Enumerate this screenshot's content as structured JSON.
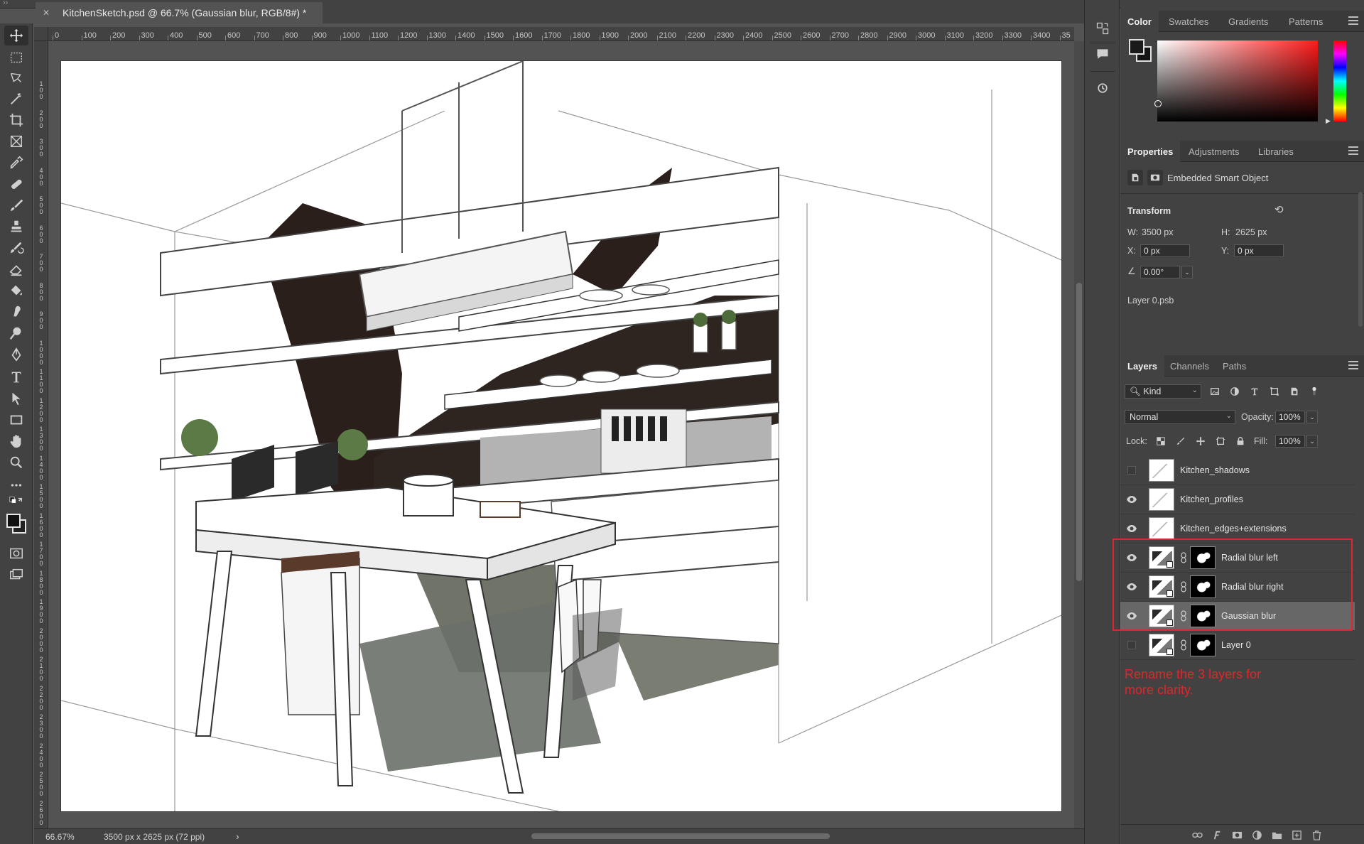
{
  "document": {
    "tab_title": "KitchenSketch.psd @ 66.7% (Gaussian blur, RGB/8#) *"
  },
  "ruler": {
    "top_ticks": [
      "0",
      "100",
      "200",
      "300",
      "400",
      "500",
      "600",
      "700",
      "800",
      "900",
      "1000",
      "1100",
      "1200",
      "1300",
      "1400",
      "1500",
      "1600",
      "1700",
      "1800",
      "1900",
      "2000",
      "2100",
      "2200",
      "2300",
      "2400",
      "2500",
      "2600",
      "2700",
      "2800",
      "2900",
      "3000",
      "3100",
      "3200",
      "3300",
      "3400",
      "35"
    ],
    "left_ticks": [
      "1\n0\n0",
      "2\n0\n0",
      "3\n0\n0",
      "4\n0\n0",
      "5\n0\n0",
      "6\n0\n0",
      "7\n0\n0",
      "8\n0\n0",
      "9\n0\n0",
      "1\n0\n0\n0",
      "1\n1\n0\n0",
      "1\n2\n0\n0",
      "1\n3\n0\n0",
      "1\n4\n0\n0",
      "1\n5\n0\n0",
      "1\n6\n0\n0",
      "1\n7\n0\n0",
      "1\n8\n0\n0",
      "1\n9\n0\n0",
      "2\n0\n0\n0",
      "2\n1\n0\n0",
      "2\n2\n0\n0",
      "2\n3\n0\n0",
      "2\n4\n0\n0",
      "2\n5\n0\n0",
      "2\n6\n0\n0"
    ]
  },
  "status": {
    "zoom": "66.67%",
    "doc_info": "3500 px x 2625 px (72 ppi)",
    "more": "›"
  },
  "color_panel": {
    "tabs": [
      "Color",
      "Swatches",
      "Gradients",
      "Patterns"
    ],
    "active_tab": "Color"
  },
  "properties_panel": {
    "tabs": [
      "Properties",
      "Adjustments",
      "Libraries"
    ],
    "object_type": "Embedded Smart Object",
    "transform_title": "Transform",
    "w_label": "W:",
    "w_value": "3500 px",
    "h_label": "H:",
    "h_value": "2625 px",
    "x_label": "X:",
    "x_value": "0 px",
    "y_label": "Y:",
    "y_value": "0 px",
    "angle_value": "0.00°",
    "linked_file": "Layer 0.psb"
  },
  "layers_panel": {
    "tabs": [
      "Layers",
      "Channels",
      "Paths"
    ],
    "filter_kind": "Kind",
    "blend_mode": "Normal",
    "opacity_label": "Opacity:",
    "opacity_value": "100%",
    "lock_label": "Lock:",
    "fill_label": "Fill:",
    "fill_value": "100%",
    "layers": [
      {
        "name": "Kitchen_shadows",
        "visible": false,
        "has_mask": false,
        "selected": false
      },
      {
        "name": "Kitchen_profiles",
        "visible": true,
        "has_mask": false,
        "selected": false
      },
      {
        "name": "Kitchen_edges+extensions",
        "visible": true,
        "has_mask": false,
        "selected": false
      },
      {
        "name": "Radial blur left",
        "visible": true,
        "has_mask": true,
        "selected": false
      },
      {
        "name": "Radial blur right",
        "visible": true,
        "has_mask": true,
        "selected": false
      },
      {
        "name": "Gaussian blur",
        "visible": true,
        "has_mask": true,
        "selected": true
      },
      {
        "name": "Layer 0",
        "visible": false,
        "has_mask": true,
        "selected": false
      }
    ],
    "annotation": "Rename the 3 layers for more clarity."
  },
  "colors": {
    "panel_bg": "#424242",
    "canvas_bg": "#535353",
    "highlight_red": "#e0262b",
    "selected_row": "#676767"
  }
}
